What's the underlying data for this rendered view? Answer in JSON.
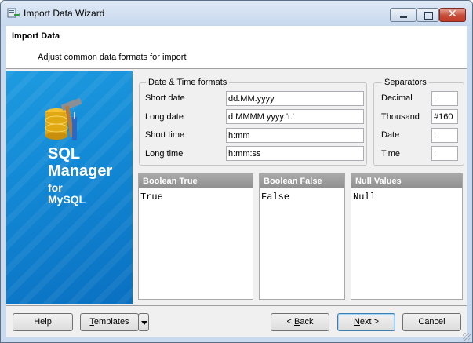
{
  "window": {
    "title": "Import Data Wizard",
    "caption_buttons": {
      "minimize": "minimize",
      "maximize": "maximize",
      "close": "✕"
    }
  },
  "header": {
    "title": "Import Data",
    "subtitle": "Adjust common data formats for import"
  },
  "banner": {
    "line1": "SQL",
    "line2": "Manager",
    "line3": "for",
    "line4": "MySQL",
    "logo_icon": "database-tools-icon"
  },
  "datetime": {
    "group_title": "Date & Time formats",
    "short_date_label": "Short date",
    "short_date_value": "dd.MM.yyyy",
    "long_date_label": "Long date",
    "long_date_value": "d MMMM yyyy 'г.'",
    "short_time_label": "Short time",
    "short_time_value": "h:mm",
    "long_time_label": "Long time",
    "long_time_value": "h:mm:ss"
  },
  "separators": {
    "group_title": "Separators",
    "decimal_label": "Decimal",
    "decimal_value": ",",
    "thousand_label": "Thousand",
    "thousand_value": "#160",
    "date_label": "Date",
    "date_value": ".",
    "time_label": "Time",
    "time_value": ":"
  },
  "panels": {
    "boolean_true": {
      "title": "Boolean True",
      "value": "True"
    },
    "boolean_false": {
      "title": "Boolean False",
      "value": "False"
    },
    "null_values": {
      "title": "Null Values",
      "value": "Null"
    }
  },
  "footer": {
    "help": "Help",
    "templates_first": "T",
    "templates_rest": "emplates",
    "back_lt": "< ",
    "back_first": "B",
    "back_rest": "ack",
    "next_first": "N",
    "next_rest": "ext >",
    "cancel": "Cancel"
  },
  "colors": {
    "banner_blue": "#138ad6",
    "panel_header": "#9a9a9a",
    "close_red": "#c74d3a"
  }
}
